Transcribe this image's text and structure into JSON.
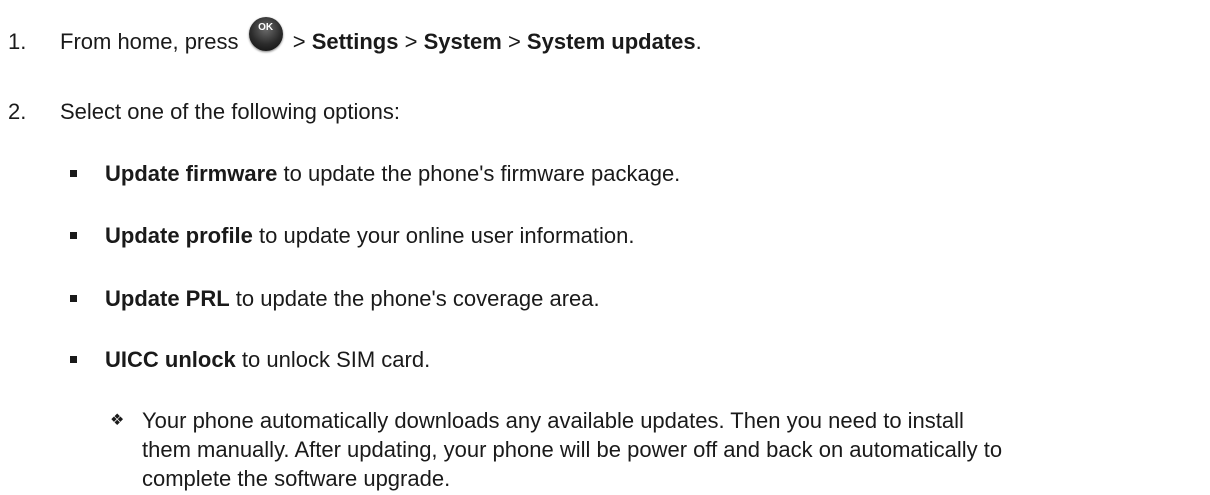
{
  "steps": [
    {
      "num": "1.",
      "pre": "From home, press ",
      "ok_label": "OK",
      "sep1": " > ",
      "p1": "Settings",
      "sep2": " > ",
      "p2": "System",
      "sep3": " > ",
      "p3": "System updates",
      "end": "."
    },
    {
      "num": "2.",
      "text": "Select one of the following options:"
    }
  ],
  "options": [
    {
      "bold": "Update firmware",
      "rest": " to update the phone's firmware package."
    },
    {
      "bold": "Update profile",
      "rest": " to update your online user information."
    },
    {
      "bold": "Update PRL",
      "rest": " to update the phone's coverage area."
    },
    {
      "bold": "UICC unlock",
      "rest": " to unlock SIM card."
    }
  ],
  "note": {
    "symbol": "❖",
    "lines": [
      "Your phone automatically downloads any available updates. Then you need to install",
      "them manually. After updating, your phone will be power off and back on automatically to",
      "complete the software upgrade."
    ]
  }
}
